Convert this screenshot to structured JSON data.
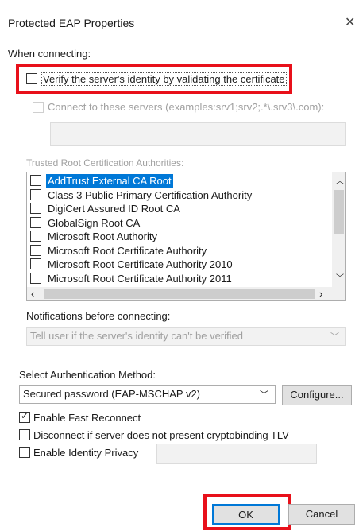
{
  "window": {
    "title": "Protected EAP Properties",
    "close_glyph": "✕"
  },
  "connecting": {
    "heading": "When connecting:",
    "verify_label": "Verify the server's identity by validating the certificate",
    "verify_checked": false,
    "connect_servers_label": "Connect to these servers (examples:srv1;srv2;.*\\.srv3\\.com):",
    "servers_value": ""
  },
  "trusted": {
    "heading": "Trusted Root Certification Authorities:",
    "items": [
      {
        "label": "AddTrust External CA Root",
        "checked": false,
        "selected": true
      },
      {
        "label": "Class 3 Public Primary Certification Authority",
        "checked": false,
        "selected": false
      },
      {
        "label": "DigiCert Assured ID Root CA",
        "checked": false,
        "selected": false
      },
      {
        "label": "GlobalSign Root CA",
        "checked": false,
        "selected": false
      },
      {
        "label": "Microsoft Root Authority",
        "checked": false,
        "selected": false
      },
      {
        "label": "Microsoft Root Certificate Authority",
        "checked": false,
        "selected": false
      },
      {
        "label": "Microsoft Root Certificate Authority 2010",
        "checked": false,
        "selected": false
      },
      {
        "label": "Microsoft Root Certificate Authority 2011",
        "checked": false,
        "selected": false
      }
    ]
  },
  "notifications": {
    "heading": "Notifications before connecting:",
    "selected": "Tell user if the server's identity can't be verified"
  },
  "auth": {
    "heading": "Select Authentication Method:",
    "selected": "Secured password (EAP-MSCHAP v2)",
    "configure_label": "Configure..."
  },
  "options": {
    "fast_reconnect_label": "Enable Fast Reconnect",
    "fast_reconnect_checked": true,
    "disconnect_label": "Disconnect if server does not present cryptobinding TLV",
    "disconnect_checked": false,
    "identity_privacy_label": "Enable Identity Privacy",
    "identity_privacy_checked": false,
    "identity_value": ""
  },
  "buttons": {
    "ok_label": "OK",
    "cancel_label": "Cancel"
  },
  "colors": {
    "highlight": "#e8101a",
    "selection": "#0078d7",
    "accent_border": "#0078d7"
  }
}
